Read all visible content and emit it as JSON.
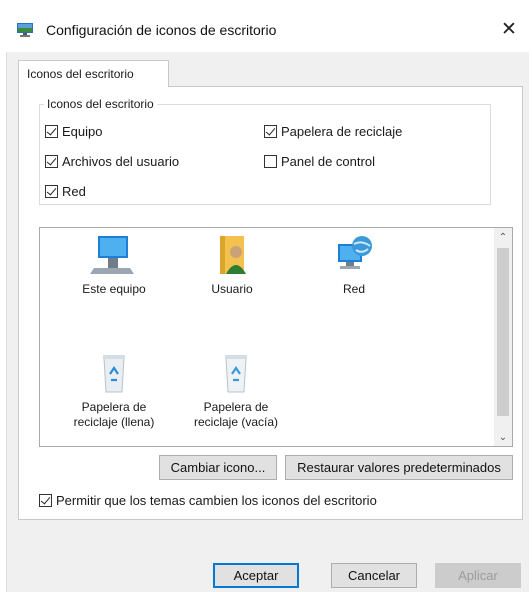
{
  "window": {
    "title": "Configuración de iconos de escritorio",
    "close_glyph": "✕",
    "icon": "desktop-settings-icon"
  },
  "tab": {
    "label": "Iconos del escritorio"
  },
  "group": {
    "legend": "Iconos del escritorio",
    "checkboxes": [
      {
        "label": "Equipo",
        "checked": true
      },
      {
        "label": "Archivos del usuario",
        "checked": true
      },
      {
        "label": "Red",
        "checked": true
      },
      {
        "label": "Papelera de reciclaje",
        "checked": true
      },
      {
        "label": "Panel de control",
        "checked": false
      }
    ]
  },
  "icon_list": {
    "items": [
      {
        "label": "Este equipo",
        "icon": "computer-icon"
      },
      {
        "label": "Usuario",
        "icon": "user-folder-icon"
      },
      {
        "label": "Red",
        "icon": "network-icon"
      },
      {
        "label_line1": "Papelera de",
        "label_line2": "reciclaje (llena)",
        "icon": "recycle-bin-full-icon"
      },
      {
        "label_line1": "Papelera de",
        "label_line2": "reciclaje (vacía)",
        "icon": "recycle-bin-empty-icon"
      }
    ]
  },
  "buttons": {
    "change_icon": "Cambiar icono...",
    "restore_defaults": "Restaurar valores predeterminados",
    "ok": "Aceptar",
    "cancel": "Cancelar",
    "apply": "Aplicar"
  },
  "themes_checkbox": {
    "label": "Permitir que los temas cambien los iconos del escritorio",
    "checked": true
  },
  "colors": {
    "accent": "#0078d7",
    "dialog_bg": "#f0f0f0",
    "panel_bg": "#ffffff"
  }
}
